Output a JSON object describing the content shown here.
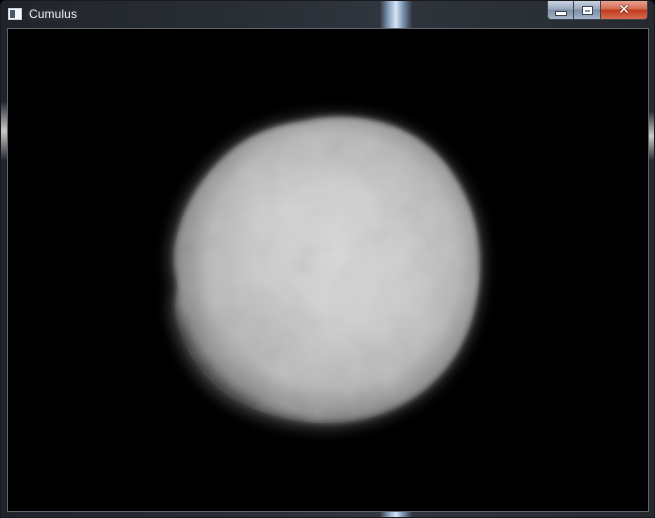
{
  "window": {
    "title": "Cumulus",
    "icon": "app-window-icon",
    "controls": {
      "minimize_icon": "minimize-icon",
      "maximize_icon": "maximize-icon",
      "close_icon": "close-icon",
      "close_glyph": "✕"
    }
  },
  "canvas": {
    "background": "#000000",
    "content": "rendered-cloud-sphere"
  }
}
